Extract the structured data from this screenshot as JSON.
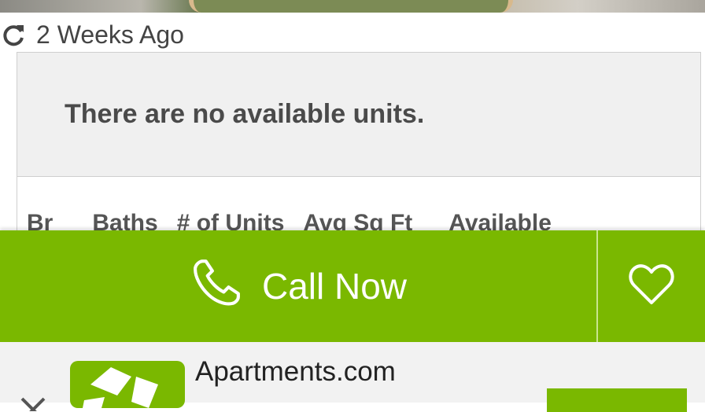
{
  "listing": {
    "updated_text": "2 Weeks Ago",
    "no_units_message": "There are no available units.",
    "table_headers": [
      "Br",
      "Baths",
      "# of Units",
      "Avg Sq Ft",
      "Available"
    ]
  },
  "action_bar": {
    "call_label": "Call Now",
    "color": "#7ab800"
  },
  "app_banner": {
    "app_name": "Apartments.com"
  },
  "icons": [
    "refresh-icon",
    "phone-icon",
    "heart-icon",
    "apartments-logo",
    "close-icon"
  ]
}
